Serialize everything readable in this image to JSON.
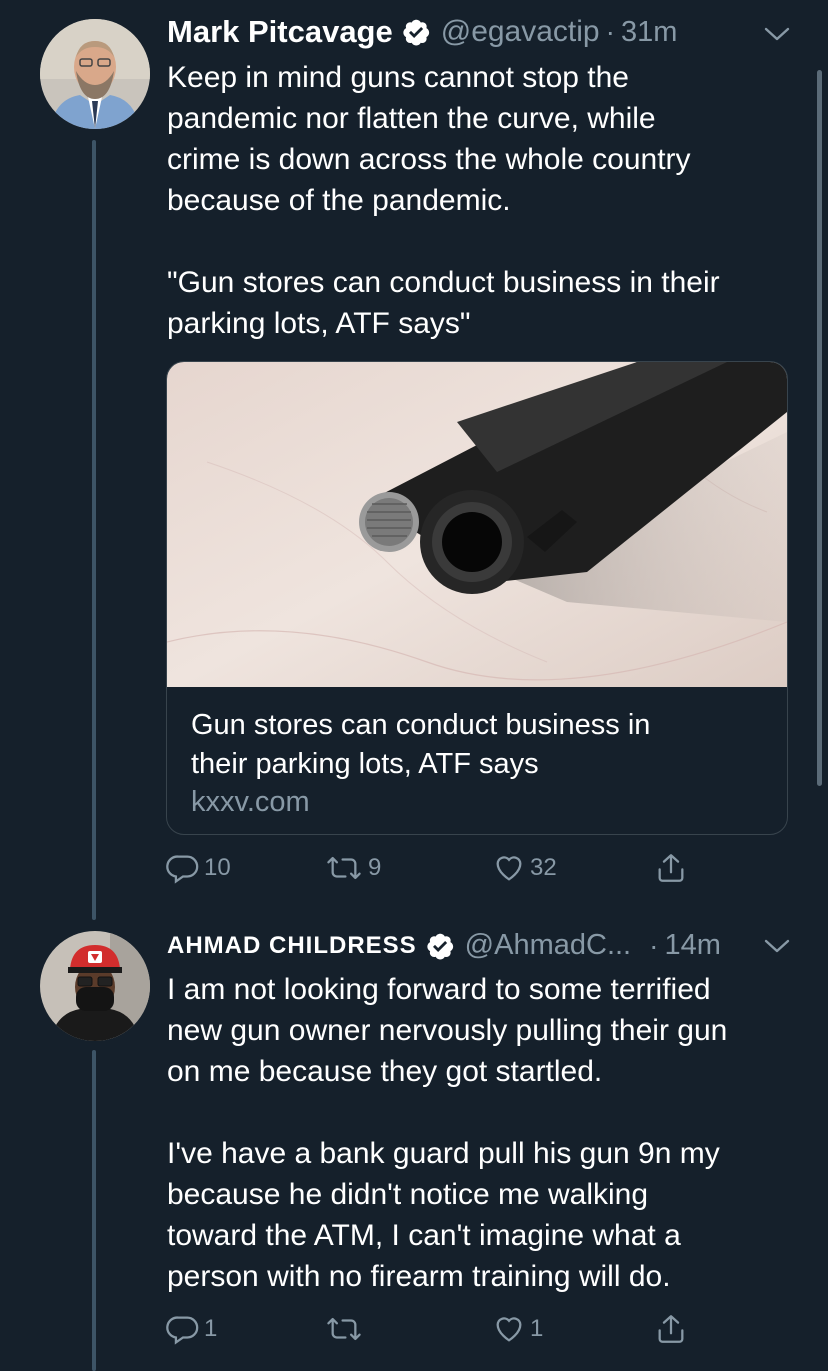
{
  "colors": {
    "background": "#15202b",
    "text_primary": "#ffffff",
    "text_secondary": "#8899a6",
    "verified_badge": "#ffffff",
    "thread_line": "#3d5466"
  },
  "tweets": [
    {
      "display_name": "Mark Pitcavage",
      "verified": true,
      "handle": "@egavactip",
      "separator": "·",
      "time": "31m",
      "text": "Keep in mind guns cannot stop the\npandemic nor flatten the curve, while\ncrime is down across the whole country\nbecause of the pandemic.\n\n\"Gun stores can conduct business in their\nparking lots, ATF says\"",
      "card": {
        "title": "Gun stores can conduct business in\ntheir parking lots, ATF says",
        "domain": "kxxv.com",
        "image_icon": "handgun-photo"
      },
      "actions": {
        "reply_count": "10",
        "retweet_count": "9",
        "like_count": "32"
      }
    },
    {
      "display_name": "AHMAD CHILDRESS",
      "verified": true,
      "handle": "@AhmadC...",
      "separator": "·",
      "time": "14m",
      "text": "I am not looking forward to some terrified\nnew gun owner nervously pulling their gun\non me because they got startled.\n\nI've have a bank guard pull his gun 9n my\nbecause he didn't notice me walking\ntoward the ATM, I can't imagine what a\nperson with no firearm training will do.",
      "actions": {
        "reply_count": "1",
        "retweet_count": "",
        "like_count": "1"
      }
    }
  ],
  "icons": {
    "reply": "reply-icon",
    "retweet": "retweet-icon",
    "like": "heart-icon",
    "share": "share-icon",
    "more": "chevron-down-icon",
    "verified": "verified-badge-icon"
  }
}
